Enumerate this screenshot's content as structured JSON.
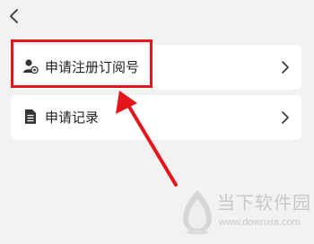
{
  "nav": {
    "back_icon": "chevron-left-icon"
  },
  "items": [
    {
      "label": "申请注册订阅号",
      "icon": "user-badge-icon"
    },
    {
      "label": "申请记录",
      "icon": "document-icon"
    }
  ],
  "annotation": {
    "highlight_color": "#e5161b"
  },
  "watermark": {
    "brand": "当下软件园",
    "url": "www.downxia.com"
  }
}
